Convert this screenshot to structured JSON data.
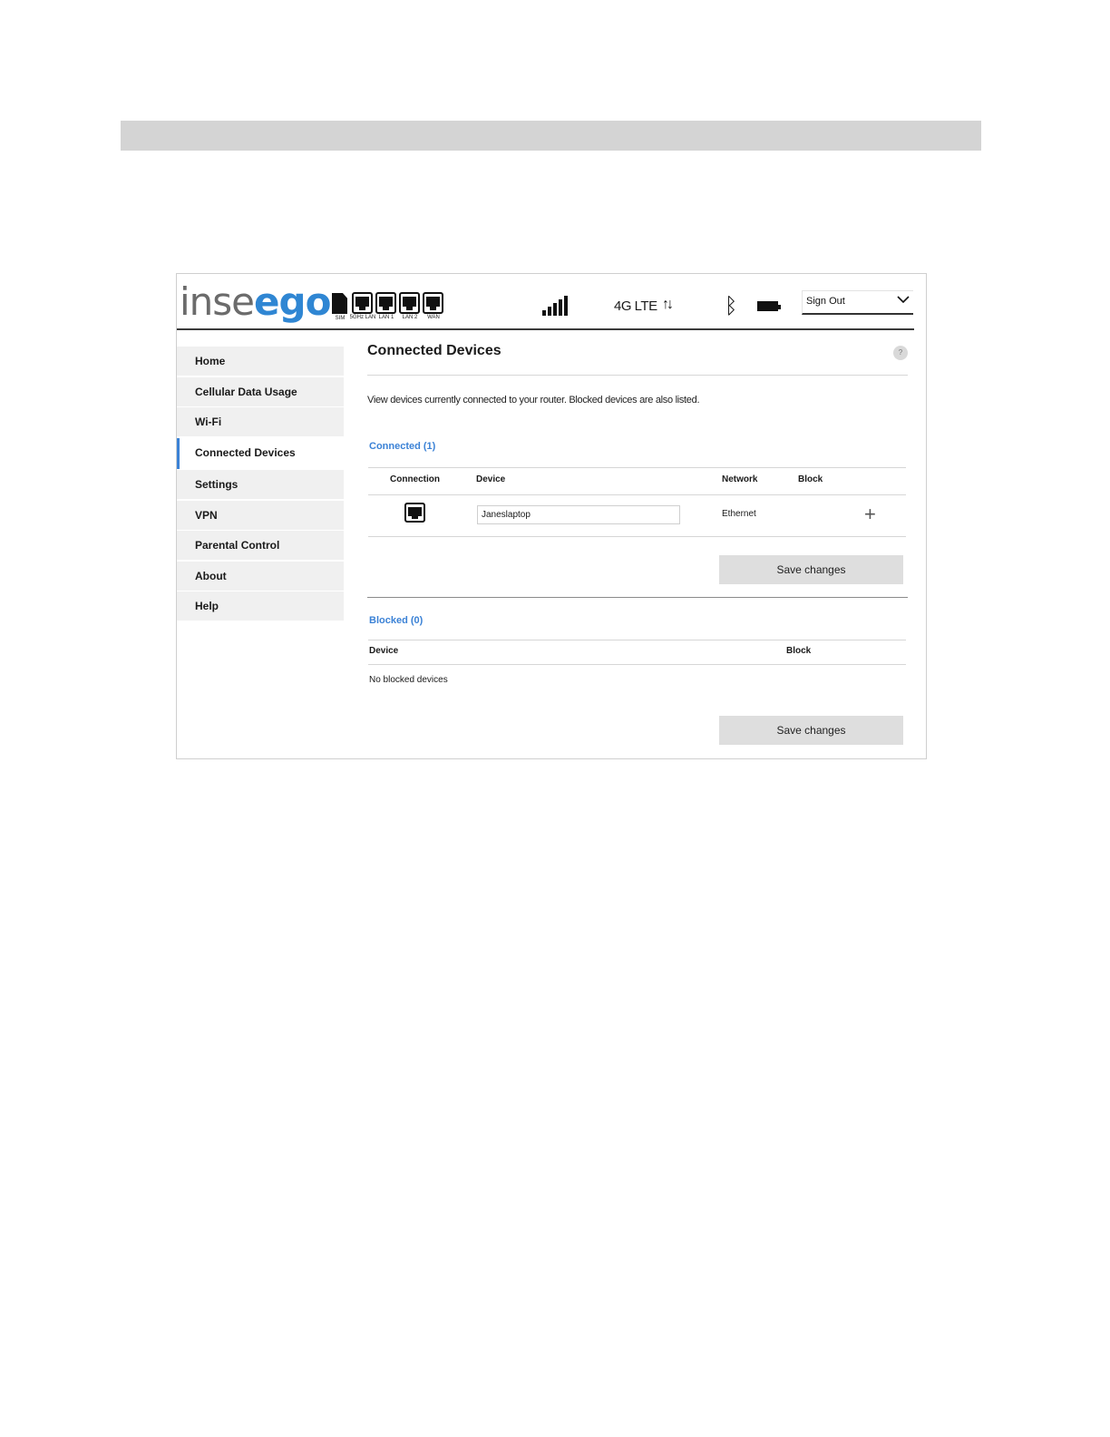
{
  "header": {
    "logo_part1": "inse",
    "logo_part2": "ego",
    "ports": [
      {
        "label": "SIM",
        "icon": "sim-card-icon"
      },
      {
        "label": "5GHz LAN",
        "icon": "ethernet-port-icon"
      },
      {
        "label": "LAN 1",
        "icon": "ethernet-port-icon"
      },
      {
        "label": "LAN 2",
        "icon": "ethernet-port-icon"
      },
      {
        "label": "WAN",
        "icon": "ethernet-port-icon"
      }
    ],
    "network_type": "4G LTE",
    "data_arrows": "↑↓",
    "bluetooth_glyph": "ᛒ",
    "signout_label": "Sign Out",
    "icons": [
      "signal-bars-icon",
      "data-arrows-icon",
      "bluetooth-icon",
      "battery-icon",
      "chevron-down-icon"
    ]
  },
  "sidebar": {
    "items": [
      {
        "label": "Home"
      },
      {
        "label": "Cellular Data Usage"
      },
      {
        "label": "Wi-Fi"
      },
      {
        "label": "Connected Devices",
        "active": true
      },
      {
        "label": "Settings"
      },
      {
        "label": "VPN"
      },
      {
        "label": "Parental Control"
      },
      {
        "label": "About"
      },
      {
        "label": "Help"
      }
    ]
  },
  "main": {
    "title": "Connected Devices",
    "help_glyph": "?",
    "description": "View devices currently connected to your router. Blocked devices are also listed.",
    "connected": {
      "title": "Connected (1)",
      "columns": [
        "Connection",
        "Device",
        "Network",
        "Block"
      ],
      "rows": [
        {
          "connection_icon": "ethernet-port-icon",
          "device": "Janeslaptop",
          "network": "Ethernet",
          "block_glyph": "+"
        }
      ],
      "save_label": "Save changes"
    },
    "blocked": {
      "title": "Blocked (0)",
      "columns": [
        "Device",
        "Block"
      ],
      "empty_text": "No blocked devices",
      "save_label": "Save changes"
    }
  },
  "colors": {
    "accent": "#3b82d6",
    "logo_gray": "#6b6b6b",
    "nav_bg": "#f0f0f0",
    "button_bg": "#dedede"
  }
}
